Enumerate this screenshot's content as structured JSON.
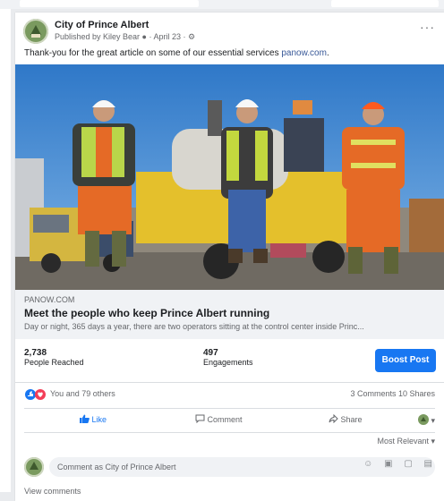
{
  "post": {
    "page_name": "City of Prince Albert",
    "meta": "Published by Kiley Bear ● · April 23 · ⚙",
    "more": "···",
    "caption_text": "Thank-you for the great article on some of our essential services ",
    "caption_link": "panow.com",
    "caption_end": "."
  },
  "link": {
    "domain": "PANOW.COM",
    "title": "Meet the people who keep Prince Albert running",
    "description": "Day or night, 365 days a year, there are two operators sitting at the control center inside Princ..."
  },
  "stats": {
    "reached_count": "2,738",
    "reached_label": "People Reached",
    "engagements_count": "497",
    "engagements_label": "Engagements",
    "boost_label": "Boost Post"
  },
  "reactions": {
    "text": "You and 79 others",
    "comments_shares": "3 Comments  10 Shares"
  },
  "actions": {
    "like": "Like",
    "comment": "Comment",
    "share": "Share",
    "avatar_selector": "▾"
  },
  "sort_label": "Most Relevant ▾",
  "comment_placeholder": "Comment as City of Prince Albert",
  "comment_tools": "☺ ▣ ▢ ▤",
  "view_comments": "View comments",
  "colors": {
    "accent": "#1877f2",
    "link": "#385898",
    "muted": "#65676b"
  }
}
